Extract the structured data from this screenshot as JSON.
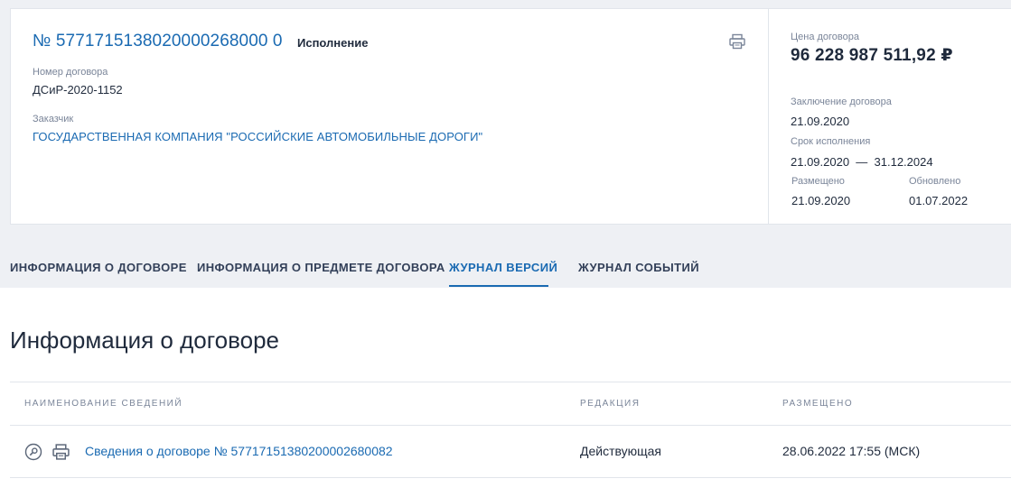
{
  "contract": {
    "reg_number": "№ 5771715138020000268000 0",
    "status": "Исполнение",
    "number_label": "Номер договора",
    "number_value": "ДСиР-2020-1152",
    "customer_label": "Заказчик",
    "customer_value": "ГОСУДАРСТВЕННАЯ КОМПАНИЯ \"РОССИЙСКИЕ АВТОМОБИЛЬНЫЕ ДОРОГИ\""
  },
  "summary": {
    "price_label": "Цена договора",
    "price_value": "96 228 987 511,92 ₽",
    "conclusion_label": "Заключение договора",
    "conclusion_value": "21.09.2020",
    "term_label": "Срок исполнения",
    "term_value": "21.09.2020  —  31.12.2024",
    "placed_label": "Размещено",
    "placed_value": "21.09.2020",
    "updated_label": "Обновлено",
    "updated_value": "01.07.2022"
  },
  "tabs": [
    {
      "label": "ИНФОРМАЦИЯ О ДОГОВОРЕ"
    },
    {
      "label": "ИНФОРМАЦИЯ О ПРЕДМЕТЕ ДОГОВОРА"
    },
    {
      "label": "ЖУРНАЛ ВЕРСИЙ",
      "active": true
    },
    {
      "label": "ЖУРНАЛ СОБЫТИЙ"
    }
  ],
  "versions": {
    "title": "Информация о договоре",
    "columns": [
      "Наименование сведений",
      "Редакция",
      "Размещено"
    ],
    "rows": [
      {
        "name": "Сведения о договоре № 57717151380200002680082",
        "edition": "Действующая",
        "placed": "28.06.2022 17:55 (МСК)"
      }
    ]
  },
  "colors": {
    "accent": "#1a6ab2",
    "text": "#1f2a3c",
    "muted": "#7a8599"
  },
  "icons": [
    "print-icon",
    "magnifier-icon"
  ]
}
